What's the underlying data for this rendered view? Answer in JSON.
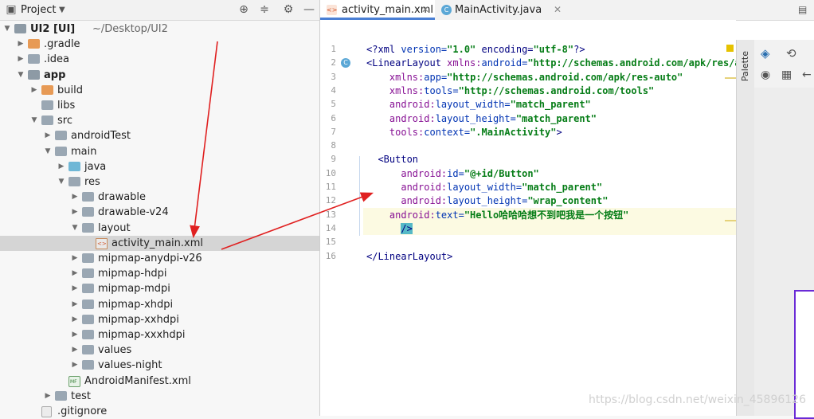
{
  "project_header": {
    "title": "Project",
    "dropdown_icon": "chevron-down-icon",
    "icons": [
      "target-icon",
      "collapse-icon",
      "gear-icon",
      "minimize-icon"
    ]
  },
  "tree": [
    {
      "label": "UI2 [UI]",
      "suffix": "~/Desktop/UI2",
      "indent": 0,
      "arrow": "down",
      "icon": "module",
      "bold": true
    },
    {
      "label": ".gradle",
      "indent": 1,
      "arrow": "right",
      "icon": "folder-orange"
    },
    {
      "label": ".idea",
      "indent": 1,
      "arrow": "right",
      "icon": "folder"
    },
    {
      "label": "app",
      "indent": 1,
      "arrow": "down",
      "icon": "module",
      "bold": true
    },
    {
      "label": "build",
      "indent": 2,
      "arrow": "right",
      "icon": "folder-orange"
    },
    {
      "label": "libs",
      "indent": 2,
      "arrow": "",
      "icon": "folder"
    },
    {
      "label": "src",
      "indent": 2,
      "arrow": "down",
      "icon": "folder"
    },
    {
      "label": "androidTest",
      "indent": 3,
      "arrow": "right",
      "icon": "folder"
    },
    {
      "label": "main",
      "indent": 3,
      "arrow": "down",
      "icon": "folder"
    },
    {
      "label": "java",
      "indent": 4,
      "arrow": "right",
      "icon": "folder-blue"
    },
    {
      "label": "res",
      "indent": 4,
      "arrow": "down",
      "icon": "folder-res"
    },
    {
      "label": "drawable",
      "indent": 5,
      "arrow": "right",
      "icon": "folder"
    },
    {
      "label": "drawable-v24",
      "indent": 5,
      "arrow": "right",
      "icon": "folder"
    },
    {
      "label": "layout",
      "indent": 5,
      "arrow": "down",
      "icon": "folder"
    },
    {
      "label": "activity_main.xml",
      "indent": 6,
      "arrow": "",
      "icon": "xml",
      "selected": true
    },
    {
      "label": "mipmap-anydpi-v26",
      "indent": 5,
      "arrow": "right",
      "icon": "folder"
    },
    {
      "label": "mipmap-hdpi",
      "indent": 5,
      "arrow": "right",
      "icon": "folder"
    },
    {
      "label": "mipmap-mdpi",
      "indent": 5,
      "arrow": "right",
      "icon": "folder"
    },
    {
      "label": "mipmap-xhdpi",
      "indent": 5,
      "arrow": "right",
      "icon": "folder"
    },
    {
      "label": "mipmap-xxhdpi",
      "indent": 5,
      "arrow": "right",
      "icon": "folder"
    },
    {
      "label": "mipmap-xxxhdpi",
      "indent": 5,
      "arrow": "right",
      "icon": "folder"
    },
    {
      "label": "values",
      "indent": 5,
      "arrow": "right",
      "icon": "folder"
    },
    {
      "label": "values-night",
      "indent": 5,
      "arrow": "right",
      "icon": "folder"
    },
    {
      "label": "AndroidManifest.xml",
      "indent": 4,
      "arrow": "",
      "icon": "manifest"
    },
    {
      "label": "test",
      "indent": 3,
      "arrow": "right",
      "icon": "folder"
    },
    {
      "label": ".gitignore",
      "indent": 2,
      "arrow": "",
      "icon": "file"
    }
  ],
  "tabs": [
    {
      "label": "activity_main.xml",
      "icon": "xml-file-icon",
      "active": true
    },
    {
      "label": "MainActivity.java",
      "icon": "class-icon",
      "active": false
    }
  ],
  "editor": {
    "lines": [
      {
        "n": "1",
        "segments": [
          [
            "tag",
            "<?xml "
          ],
          [
            "attr",
            "version="
          ],
          [
            "str",
            "\"1.0\""
          ],
          [
            "tag",
            " encoding="
          ],
          [
            "str",
            "\"utf-8\""
          ],
          [
            "tag",
            "?>"
          ]
        ]
      },
      {
        "n": "2",
        "segments": [
          [
            "tag",
            "<LinearLayout "
          ],
          [
            "ns",
            "xmlns:"
          ],
          [
            "attr",
            "android="
          ],
          [
            "str",
            "\"http://schemas.android.com/apk/res/andro"
          ]
        ]
      },
      {
        "n": "3",
        "segments": [
          [
            "plain",
            "    "
          ],
          [
            "ns",
            "xmlns:"
          ],
          [
            "attr",
            "app="
          ],
          [
            "str",
            "\"http://schemas.android.com/apk/res-auto\""
          ]
        ]
      },
      {
        "n": "4",
        "segments": [
          [
            "plain",
            "    "
          ],
          [
            "ns",
            "xmlns:"
          ],
          [
            "attr",
            "tools="
          ],
          [
            "str",
            "\"http://schemas.android.com/tools\""
          ]
        ]
      },
      {
        "n": "5",
        "segments": [
          [
            "plain",
            "    "
          ],
          [
            "ns",
            "android:"
          ],
          [
            "attr",
            "layout_width="
          ],
          [
            "str",
            "\"match_parent\""
          ]
        ]
      },
      {
        "n": "6",
        "segments": [
          [
            "plain",
            "    "
          ],
          [
            "ns",
            "android:"
          ],
          [
            "attr",
            "layout_height="
          ],
          [
            "str",
            "\"match_parent\""
          ]
        ]
      },
      {
        "n": "7",
        "segments": [
          [
            "plain",
            "    "
          ],
          [
            "ns",
            "tools:"
          ],
          [
            "attr",
            "context="
          ],
          [
            "str",
            "\".MainActivity\""
          ],
          [
            "tag",
            ">"
          ]
        ]
      },
      {
        "n": "8",
        "segments": []
      },
      {
        "n": "9",
        "segments": [
          [
            "plain",
            "  "
          ],
          [
            "tag",
            "<Button"
          ]
        ]
      },
      {
        "n": "10",
        "segments": [
          [
            "plain",
            "      "
          ],
          [
            "ns",
            "android:"
          ],
          [
            "attr",
            "id="
          ],
          [
            "str",
            "\"@+id/Button\""
          ]
        ]
      },
      {
        "n": "11",
        "segments": [
          [
            "plain",
            "      "
          ],
          [
            "ns",
            "android:"
          ],
          [
            "attr",
            "layout_width="
          ],
          [
            "str",
            "\"match_parent\""
          ]
        ]
      },
      {
        "n": "12",
        "segments": [
          [
            "plain",
            "      "
          ],
          [
            "ns",
            "android:"
          ],
          [
            "attr",
            "layout_height="
          ],
          [
            "str",
            "\"wrap_content\""
          ]
        ]
      },
      {
        "n": "13",
        "segments": [
          [
            "plain",
            "    "
          ],
          [
            "ns",
            "android:"
          ],
          [
            "attr",
            "text="
          ],
          [
            "str",
            "\"Hello哈哈哈想不到吧我是一个按钮\""
          ]
        ]
      },
      {
        "n": "14",
        "segments": [
          [
            "plain",
            "      "
          ],
          [
            "tag",
            "/>"
          ]
        ]
      },
      {
        "n": "15",
        "segments": []
      },
      {
        "n": "16",
        "segments": [
          [
            "tag",
            "</LinearLayout>"
          ]
        ]
      }
    ]
  },
  "palette_label": "Palette",
  "watermark": "https://blog.csdn.net/weixin_45896126",
  "colors": {
    "accent": "#4a7fd4",
    "annotation_arrow": "#e02020",
    "selection": "#d5d5d5"
  }
}
